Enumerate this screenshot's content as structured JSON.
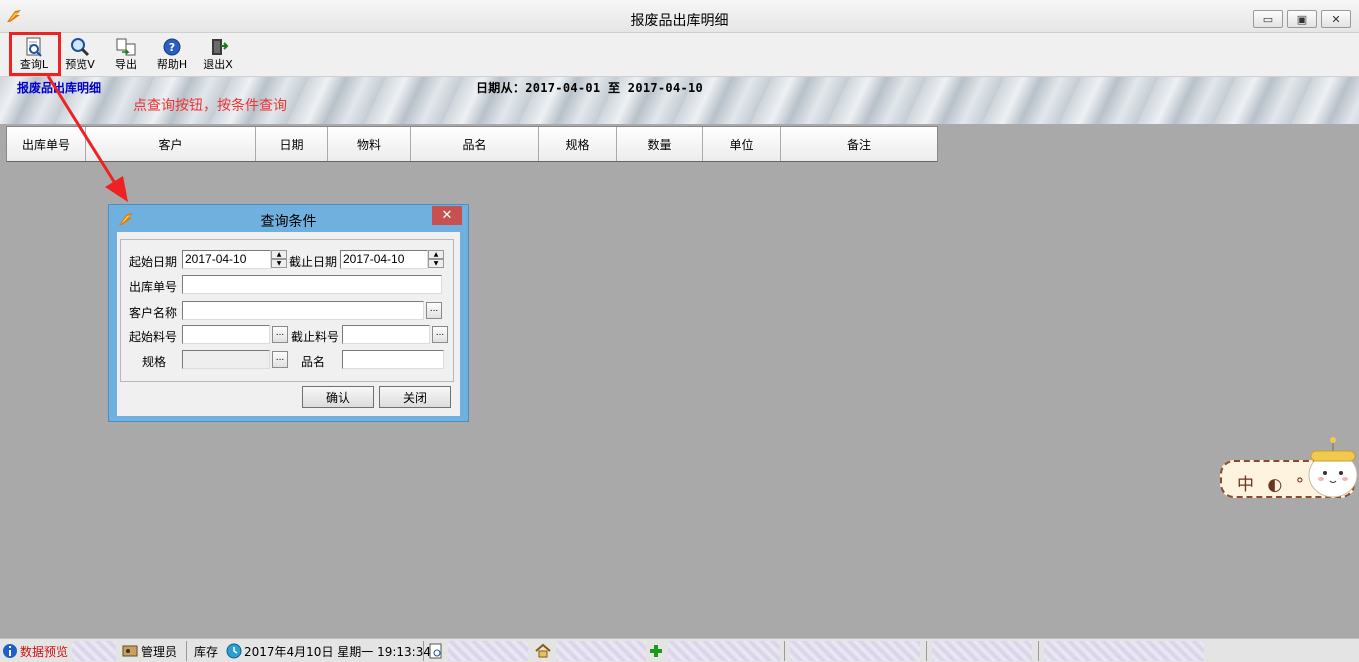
{
  "window": {
    "title": "报废品出库明细",
    "controls": {
      "minimize": "▭",
      "maximize": "▣",
      "close": "✕"
    }
  },
  "toolbar": {
    "items": [
      {
        "label": "查询L",
        "icon": "query-doc-icon"
      },
      {
        "label": "预览V",
        "icon": "magnifier-icon"
      },
      {
        "label": "导出",
        "icon": "export-icon"
      },
      {
        "label": "帮助H",
        "icon": "help-icon"
      },
      {
        "label": "退出X",
        "icon": "exit-door-icon"
      }
    ]
  },
  "banner": {
    "title": "报废品出库明细",
    "date_range": "日期从：2017-04-01 至 2017-04-10"
  },
  "annotation": {
    "text": "点查询按钮，按条件查询",
    "color": "#ee3333"
  },
  "grid": {
    "columns": [
      "出库单号",
      "客户",
      "日期",
      "物料",
      "品名",
      "规格",
      "数量",
      "单位",
      "备注"
    ]
  },
  "dialog": {
    "title": "查询条件",
    "close_label": "✕",
    "fields": {
      "start_date_label": "起始日期",
      "start_date_value": "2017-04-10",
      "end_date_label": "截止日期",
      "end_date_value": "2017-04-10",
      "order_no_label": "出库单号",
      "order_no_value": "",
      "customer_label": "客户名称",
      "customer_value": "",
      "start_item_label": "起始料号",
      "start_item_value": "",
      "end_item_label": "截止料号",
      "end_item_value": "",
      "spec_label": "规格",
      "spec_value": "",
      "name_label": "品名",
      "name_value": "",
      "ellipsis": "..."
    },
    "buttons": {
      "confirm": "确认",
      "close": "关闭"
    }
  },
  "ime": {
    "text": "中 ◐ ° 简"
  },
  "statusbar": {
    "preview": "数据预览",
    "user": "管理员",
    "module": "库存",
    "datetime": "2017年4月10日 星期一 19:13:34"
  },
  "colors": {
    "accent_red": "#ee2222",
    "banner_title": "#0000cc",
    "dialog_frame": "#6fb0de",
    "dialog_close": "#c75050"
  }
}
